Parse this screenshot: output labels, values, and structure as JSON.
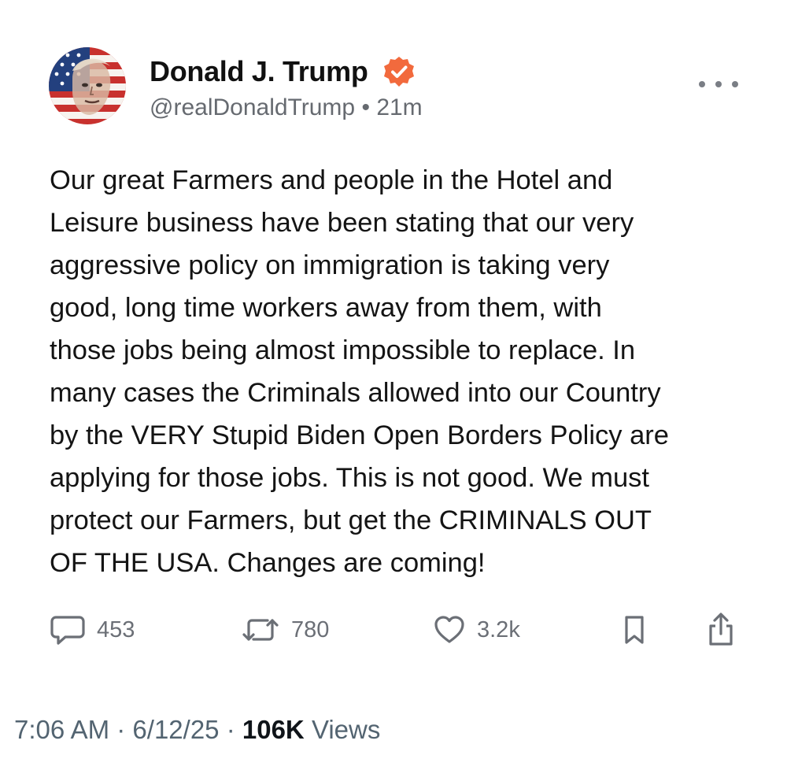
{
  "post": {
    "author": {
      "display_name": "Donald J. Trump",
      "verified_icon": "verified-badge-icon",
      "handle": "@realDonaldTrump",
      "separator": "•",
      "relative_time": "21m"
    },
    "body": "Our great Farmers and people in the Hotel and\nLeisure business have been stating that our very\naggressive policy on immigration is taking very\ngood, long time workers away from them, with\nthose jobs being almost impossible to replace. In\nmany cases the Criminals allowed into our Country\nby the VERY Stupid Biden Open Borders Policy are\napplying for those jobs. This is not good. We must\nprotect our Farmers, but get the CRIMINALS OUT\nOF THE USA. Changes are coming!",
    "actions": {
      "replies": "453",
      "reposts": "780",
      "likes": "3.2k"
    }
  },
  "meta": {
    "time": "7:06 AM",
    "dot": "·",
    "date": "6/12/25",
    "views_count": "106K",
    "views_label": "Views"
  },
  "colors": {
    "badge": "#f26a3d",
    "muted_text": "#6b6f76",
    "meta_text": "#536471"
  }
}
